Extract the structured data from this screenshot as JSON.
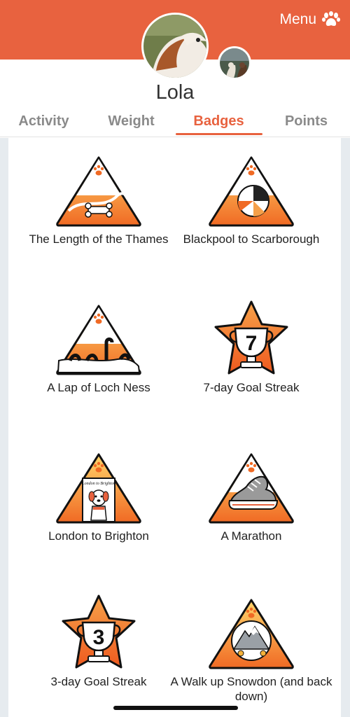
{
  "header": {
    "menu_label": "Menu",
    "menu_icon": "paw-icon",
    "pet_name": "Lola",
    "accent_color": "#e8623f"
  },
  "tabs": [
    {
      "label": "Activity",
      "active": false
    },
    {
      "label": "Weight",
      "active": false
    },
    {
      "label": "Badges",
      "active": true
    },
    {
      "label": "Points",
      "active": false
    }
  ],
  "badges": [
    {
      "label": "The Length of the Thames",
      "icon": "thames-badge-icon"
    },
    {
      "label": "Blackpool to Scarborough",
      "icon": "blackpool-badge-icon"
    },
    {
      "label": "A Lap of Loch Ness",
      "icon": "loch-ness-badge-icon"
    },
    {
      "label": "7-day Goal Streak",
      "icon": "trophy-badge-icon",
      "number": "7"
    },
    {
      "label": "London to Brighton",
      "icon": "london-brighton-badge-icon",
      "sign_text": "London to Brighton"
    },
    {
      "label": "A Marathon",
      "icon": "marathon-badge-icon"
    },
    {
      "label": "3-day Goal Streak",
      "icon": "trophy-badge-icon",
      "number": "3"
    },
    {
      "label": "A Walk up Snowdon (and back down)",
      "icon": "snowdon-badge-icon"
    }
  ]
}
